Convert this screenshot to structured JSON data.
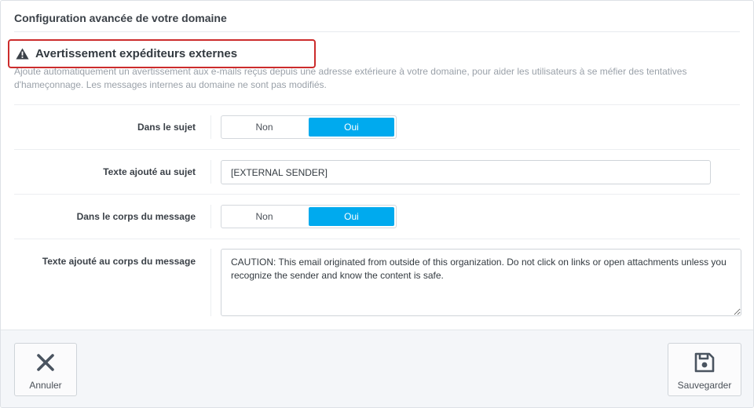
{
  "panel": {
    "title": "Configuration avancée de votre domaine"
  },
  "section": {
    "title": "Avertissement expéditeurs externes",
    "description": "Ajoute automatiquement un avertissement aux e-mails reçus depuis une adresse extérieure à votre domaine, pour aider les utilisateurs à se méfier des tentatives d'hameçonnage. Les messages internes au domaine ne sont pas modifiés.",
    "icon": "warning-triangle-icon",
    "highlight_color": "#cc2c2c"
  },
  "fields": {
    "subject_toggle": {
      "label": "Dans le sujet",
      "options": [
        "Non",
        "Oui"
      ],
      "selected": "Oui"
    },
    "subject_text": {
      "label": "Texte ajouté au sujet",
      "value": "[EXTERNAL SENDER]"
    },
    "body_toggle": {
      "label": "Dans le corps du message",
      "options": [
        "Non",
        "Oui"
      ],
      "selected": "Oui"
    },
    "body_text": {
      "label": "Texte ajouté au corps du message",
      "value": "CAUTION: This email originated from outside of this organization. Do not click on links or open attachments unless you recognize the sender and know the content is safe."
    }
  },
  "footer": {
    "cancel": {
      "label": "Annuler",
      "icon": "close-icon"
    },
    "save": {
      "label": "Sauvegarder",
      "icon": "floppy-disk-icon"
    }
  },
  "colors": {
    "accent": "#00aaee",
    "footer_bg": "#f4f6f9"
  }
}
